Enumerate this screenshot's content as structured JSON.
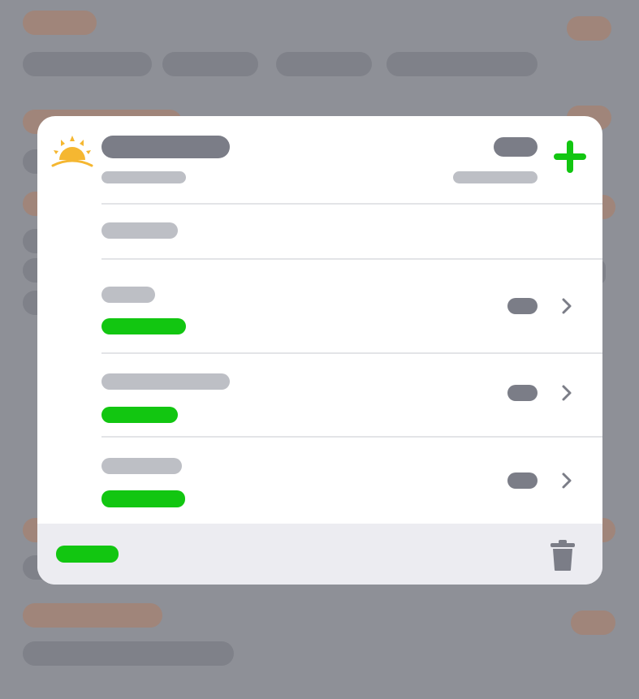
{
  "colors": {
    "overlay_background": "#8e9097",
    "placeholder_tan": "#a0857a",
    "placeholder_gray": "#7f8189",
    "card_background": "#ffffff",
    "footer_background": "#ececf1",
    "text_placeholder_dark": "#7b7d87",
    "text_placeholder_light": "#bdbfc5",
    "accent_green": "#12c611",
    "sun_yellow": "#f5b731"
  },
  "header": {
    "icon": "sunrise-icon",
    "action_icon": "plus-icon"
  },
  "rows": [
    {
      "icon": "chevron-right-icon"
    },
    {
      "icon": "chevron-right-icon"
    },
    {
      "icon": "chevron-right-icon"
    }
  ],
  "footer": {
    "icon": "trash-icon"
  }
}
